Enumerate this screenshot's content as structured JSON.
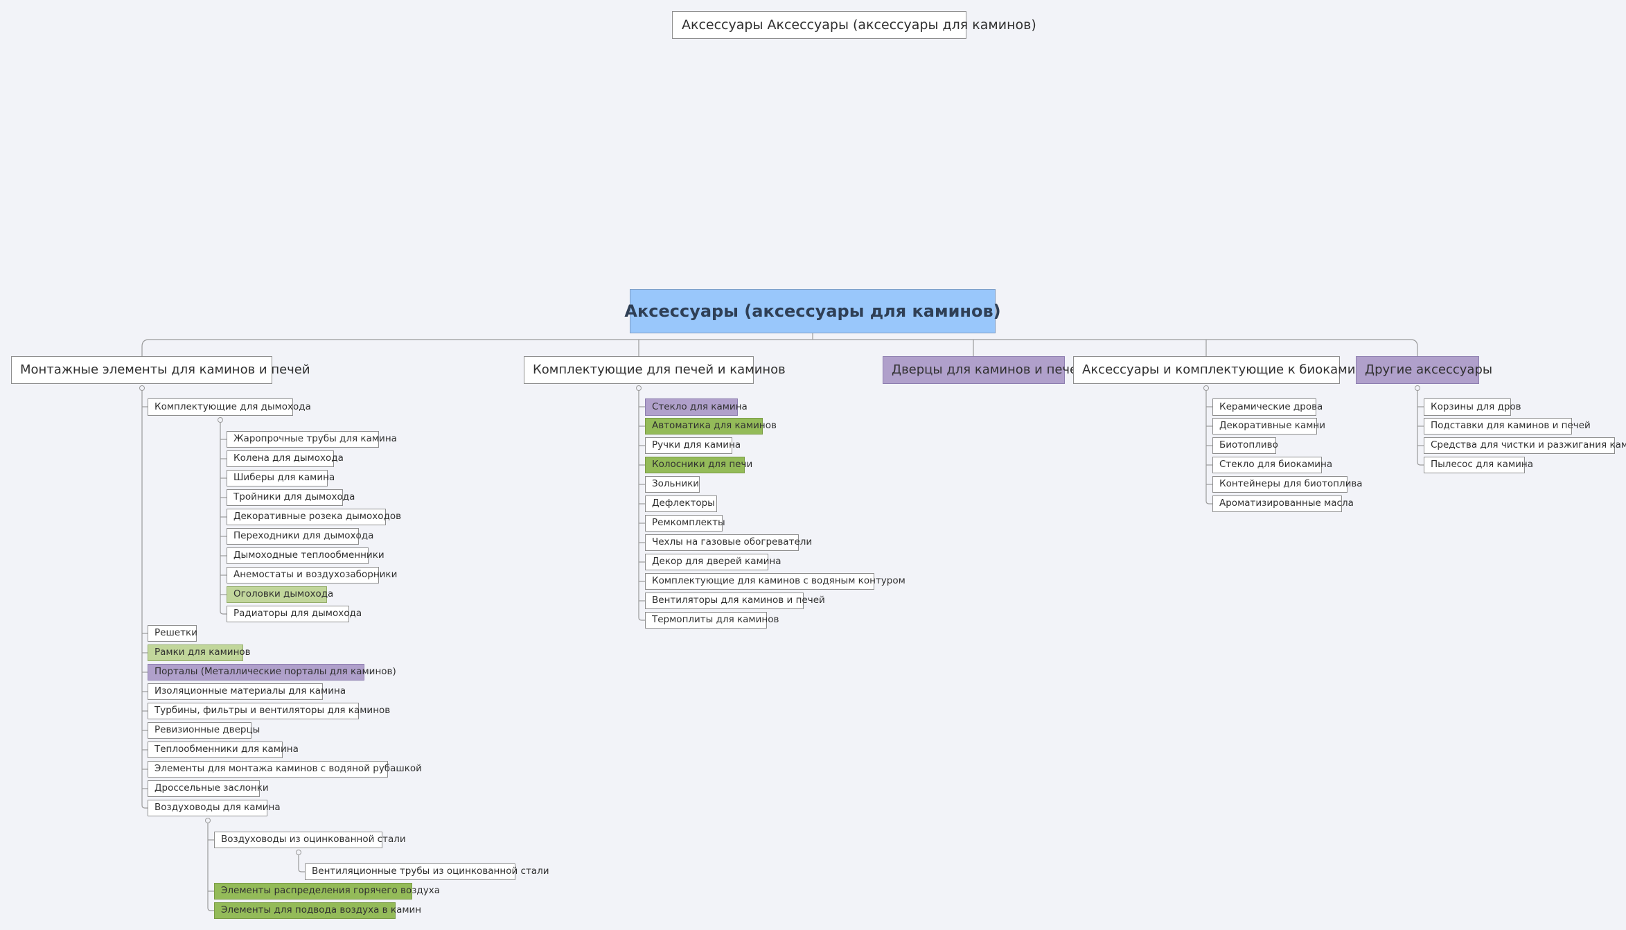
{
  "title_box": "Аксессуары Аксессуары (аксессуары для каминов)",
  "root": "Аксессуары (аксессуары для каминов)",
  "branches": [
    {
      "label": "Монтажные элементы для каминов и печей",
      "children": [
        {
          "label": "Комплектующие для дымохода",
          "children": [
            {
              "label": "Жаропрочные трубы для камина"
            },
            {
              "label": "Колена для дымохода"
            },
            {
              "label": "Шиберы для камина"
            },
            {
              "label": "Тройники для дымохода"
            },
            {
              "label": "Декоративные розека дымоходов"
            },
            {
              "label": "Переходники для дымохода"
            },
            {
              "label": "Дымоходные теплообменники"
            },
            {
              "label": "Анемостаты и воздухозаборники"
            },
            {
              "label": "Оголовки дымохода",
              "color": "#c1d69b"
            },
            {
              "label": "Радиаторы для дымохода"
            }
          ]
        },
        {
          "label": "Решетки"
        },
        {
          "label": "Рамки для каминов",
          "color": "#c1d69b"
        },
        {
          "label": "Порталы (Металлические порталы для каминов)",
          "color": "#b0a0cb"
        },
        {
          "label": "Изоляционные материалы для камина"
        },
        {
          "label": "Турбины, фильтры и вентиляторы для каминов"
        },
        {
          "label": "Ревизионные дверцы"
        },
        {
          "label": "Теплообменники для камина"
        },
        {
          "label": "Элементы для монтажа каминов с водяной рубашкой"
        },
        {
          "label": "Дроссельные заслонки"
        },
        {
          "label": "Воздуховоды для камина",
          "children": [
            {
              "label": "Воздуховоды из оцинкованной стали",
              "children": [
                {
                  "label": "Вентиляционные трубы из оцинкованной стали"
                }
              ]
            },
            {
              "label": "Элементы распределения горячего воздуха",
              "color": "#94bb59"
            },
            {
              "label": "Элементы для подвода воздуха в камин",
              "color": "#94bb59"
            }
          ]
        }
      ]
    },
    {
      "label": "Комплектующие для печей и каминов",
      "children": [
        {
          "label": "Стекло для камина",
          "color": "#b0a0cb"
        },
        {
          "label": "Автоматика для каминов",
          "color": "#94bb59"
        },
        {
          "label": "Ручки для камина"
        },
        {
          "label": "Колосники для печи",
          "color": "#94bb59"
        },
        {
          "label": "Зольники"
        },
        {
          "label": "Дефлекторы"
        },
        {
          "label": "Ремкомплекты"
        },
        {
          "label": "Чехлы на газовые обогреватели"
        },
        {
          "label": "Декор для дверей камина"
        },
        {
          "label": "Комплектующие для каминов с водяным контуром"
        },
        {
          "label": "Вентиляторы для каминов и печей"
        },
        {
          "label": "Термоплиты для каминов"
        }
      ]
    },
    {
      "label": "Дверцы для каминов и печей",
      "color": "#b0a0cb"
    },
    {
      "label": "Аксессуары и комплектующие к биокаминам",
      "children": [
        {
          "label": "Керамические дрова"
        },
        {
          "label": "Декоративные камни"
        },
        {
          "label": "Биотопливо"
        },
        {
          "label": "Стекло для биокамина"
        },
        {
          "label": "Контейнеры для биотоплива"
        },
        {
          "label": "Ароматизированные масла"
        }
      ]
    },
    {
      "label": "Другие аксессуары",
      "color": "#b0a0cb",
      "children": [
        {
          "label": "Корзины для дров"
        },
        {
          "label": "Подставки для каминов и печей"
        },
        {
          "label": "Средства для чистки и разжигания камина"
        },
        {
          "label": "Пылесос для камина"
        }
      ]
    }
  ]
}
